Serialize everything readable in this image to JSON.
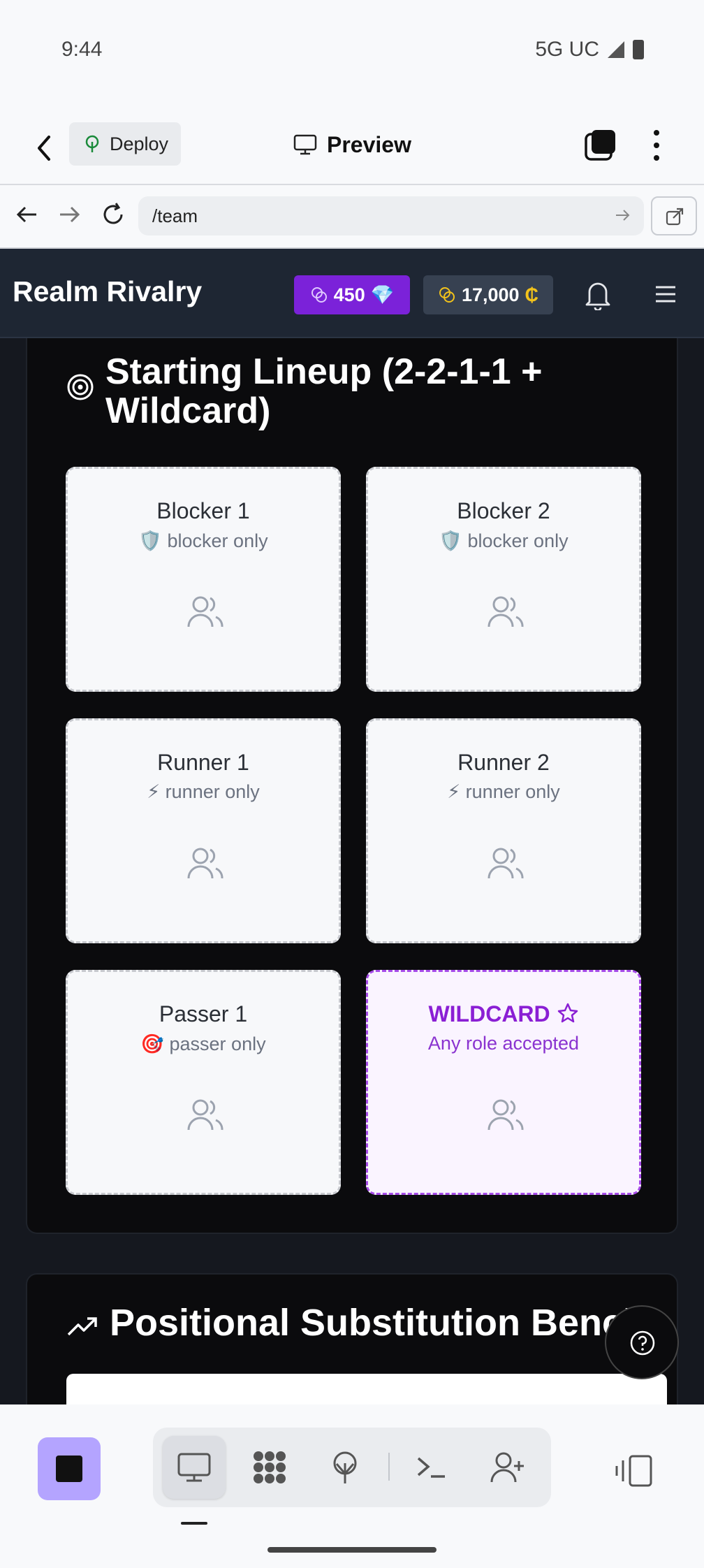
{
  "status_bar": {
    "time": "9:44",
    "network": "5G UC"
  },
  "toolbar": {
    "deploy_label": "Deploy",
    "preview_label": "Preview"
  },
  "browser": {
    "url": "/team"
  },
  "app": {
    "title": "Realm Rivalry",
    "gems": "450",
    "gem_symbol": "💎",
    "coins": "17,000",
    "coin_symbol": "₵"
  },
  "lineup": {
    "title": "Starting Lineup (2-2-1-1 + Wildcard)",
    "slots": [
      {
        "title": "Blocker 1",
        "desc": "🛡️ blocker only"
      },
      {
        "title": "Blocker 2",
        "desc": "🛡️ blocker only"
      },
      {
        "title": "Runner 1",
        "desc": "⚡ runner only"
      },
      {
        "title": "Runner 2",
        "desc": "⚡ runner only"
      },
      {
        "title": "Passer 1",
        "desc": "🎯 passer only"
      },
      {
        "title": "WILDCARD",
        "desc": "Any role accepted"
      }
    ]
  },
  "bench": {
    "title": "Positional Substitution Bench"
  },
  "colors": {
    "accent_purple": "#7b22d9",
    "header_bg": "#1e2633",
    "panel_bg": "#0b0b0d"
  }
}
